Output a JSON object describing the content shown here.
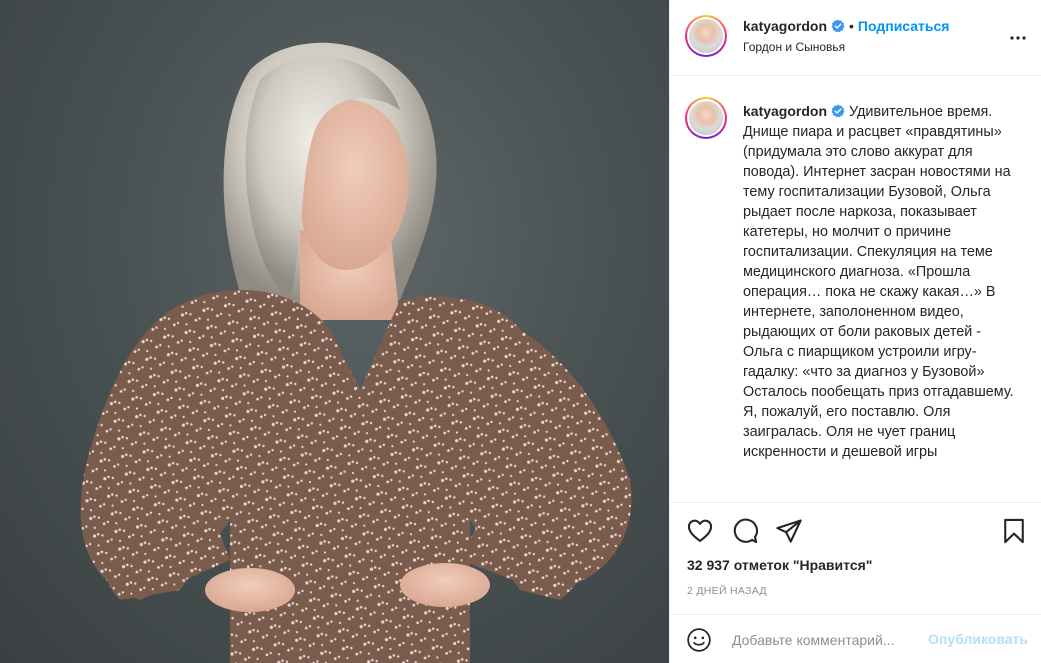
{
  "post": {
    "username": "katyagordon",
    "follow_label": "Подписаться",
    "location": "Гордон и Сыновья",
    "caption": "Удивительное время. Днище пиара и расцвет «правдятины» (придумала это слово аккурат для повода). Интернет засран новостями на тему госпитализации Бузовой, Ольга рыдает после наркоза, показывает катетеры, но молчит о причине госпитализации. Спекуляция на теме медицинского диагноза. «Прошла операция… пока не скажу какая…» В интернете, заполоненном видео, рыдающих от боли раковых детей - Ольга с пиарщиком устроили игру-гадалку: «что за диагноз у Бузовой» Осталось пообещать приз отгадавшему. Я, пожалуй, его поставлю. Оля заигралась. Оля не чует границ искренности и дешевой игры",
    "likes_text": "32 937 отметок \"Нравится\"",
    "time_ago": "2 ДНЕЙ НАЗАД",
    "comment_placeholder": "Добавьте комментарий...",
    "publish_label": "Опубликовать"
  },
  "icons": {
    "verified": "verified-badge-icon",
    "more": "more-options-icon",
    "like": "heart-icon",
    "comment": "comment-icon",
    "share": "share-icon",
    "save": "bookmark-icon",
    "emoji": "emoji-icon"
  },
  "colors": {
    "accent": "#0095f6",
    "verified": "#3897f0",
    "publish_disabled": "#b2dffc",
    "muted": "#8e8e8e"
  }
}
